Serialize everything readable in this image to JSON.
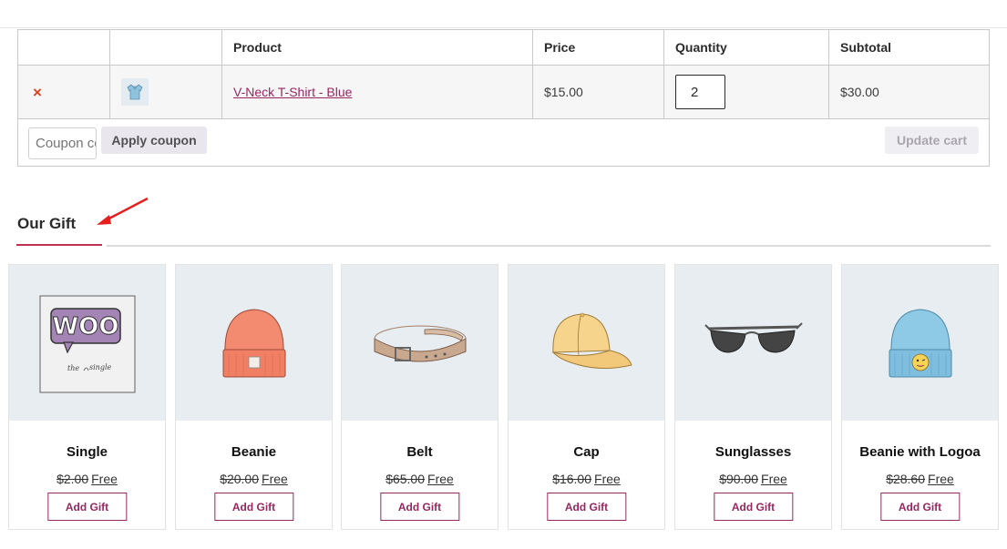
{
  "colors": {
    "accent": "#96275f",
    "remove": "#e2401c",
    "heading_underline": "#c0304f",
    "arrow": "#e51f1f",
    "image_bg": "#e8edf1"
  },
  "cart": {
    "headers": [
      "",
      "",
      "Product",
      "Price",
      "Quantity",
      "Subtotal"
    ],
    "item": {
      "remove_symbol": "×",
      "thumbnail_icon": "tshirt-icon",
      "product_name": "V-Neck T-Shirt - Blue",
      "price": "$15.00",
      "quantity": "2",
      "subtotal": "$30.00"
    },
    "coupon_placeholder": "Coupon code",
    "apply_coupon_label": "Apply coupon",
    "update_cart_label": "Update cart"
  },
  "gift_section": {
    "heading": "Our Gift",
    "items": [
      {
        "name": "Single",
        "old_price": "$2.00",
        "new_price": "Free",
        "button": "Add Gift",
        "icon": "woo-poster-icon"
      },
      {
        "name": "Beanie",
        "old_price": "$20.00",
        "new_price": "Free",
        "button": "Add Gift",
        "icon": "beanie-icon"
      },
      {
        "name": "Belt",
        "old_price": "$65.00",
        "new_price": "Free",
        "button": "Add Gift",
        "icon": "belt-icon"
      },
      {
        "name": "Cap",
        "old_price": "$16.00",
        "new_price": "Free",
        "button": "Add Gift",
        "icon": "cap-icon"
      },
      {
        "name": "Sunglasses",
        "old_price": "$90.00",
        "new_price": "Free",
        "button": "Add Gift",
        "icon": "sunglasses-icon"
      },
      {
        "name": "Beanie with Logoa",
        "old_price": "$28.60",
        "new_price": "Free",
        "button": "Add Gift",
        "icon": "beanie-logo-icon"
      }
    ]
  }
}
